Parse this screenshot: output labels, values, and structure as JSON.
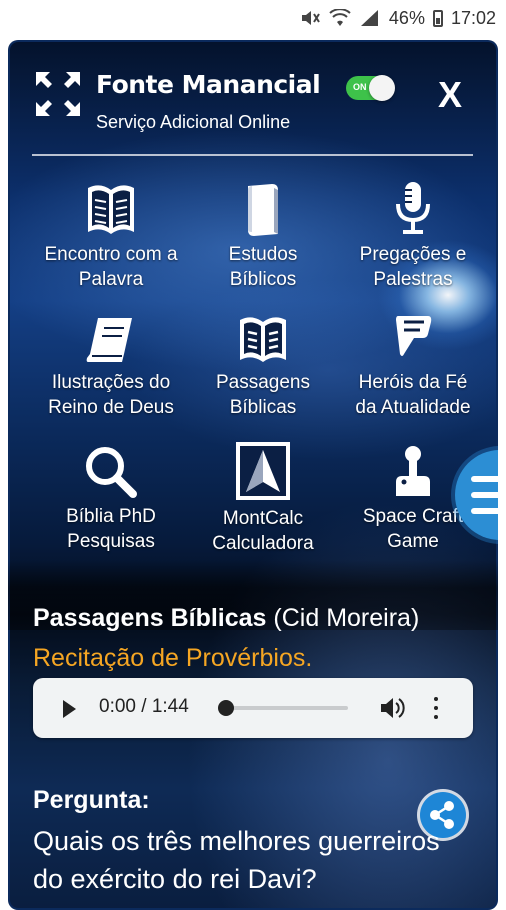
{
  "status_bar": {
    "battery": "46%",
    "time": "17:02"
  },
  "header": {
    "title": "Fonte Manancial",
    "subtitle": "Serviço Adicional Online",
    "toggle_label": "ON",
    "close_label": "X"
  },
  "grid": [
    {
      "label_1": "Encontro com a",
      "label_2": "Palavra",
      "icon": "open-book-icon"
    },
    {
      "label_1": "Estudos",
      "label_2": "Bíblicos",
      "icon": "bible-icon"
    },
    {
      "label_1": "Pregações e",
      "label_2": "Palestras",
      "icon": "microphone-icon"
    },
    {
      "label_1": "Ilustrações do",
      "label_2": "Reino de Deus",
      "icon": "book-icon"
    },
    {
      "label_1": "Passagens",
      "label_2": "Bíblicas",
      "icon": "reading-book-icon"
    },
    {
      "label_1": "Heróis da Fé",
      "label_2": "da Atualidade",
      "icon": "foursquare-icon"
    },
    {
      "label_1": "Bíblia PhD",
      "label_2": "Pesquisas",
      "icon": "search-icon"
    },
    {
      "label_1": "MontCalc",
      "label_2": "Calculadora",
      "icon": "compass-logo-icon"
    },
    {
      "label_1": "Space Craft",
      "label_2": "Game",
      "icon": "joystick-icon"
    }
  ],
  "now_playing": {
    "title": "Passagens Bíblicas",
    "author": "(Cid Moreira)",
    "subtitle": "Recitação de Provérbios."
  },
  "player": {
    "time": "0:00 / 1:44",
    "progress": 0
  },
  "question": {
    "label": "Pergunta:",
    "text": "Quais os três melhores guerreiros do exército do rei Davi?"
  },
  "colors": {
    "accent_orange": "#f5a623",
    "toggle_green": "#3ec24a",
    "share_blue": "#1e86d6"
  }
}
